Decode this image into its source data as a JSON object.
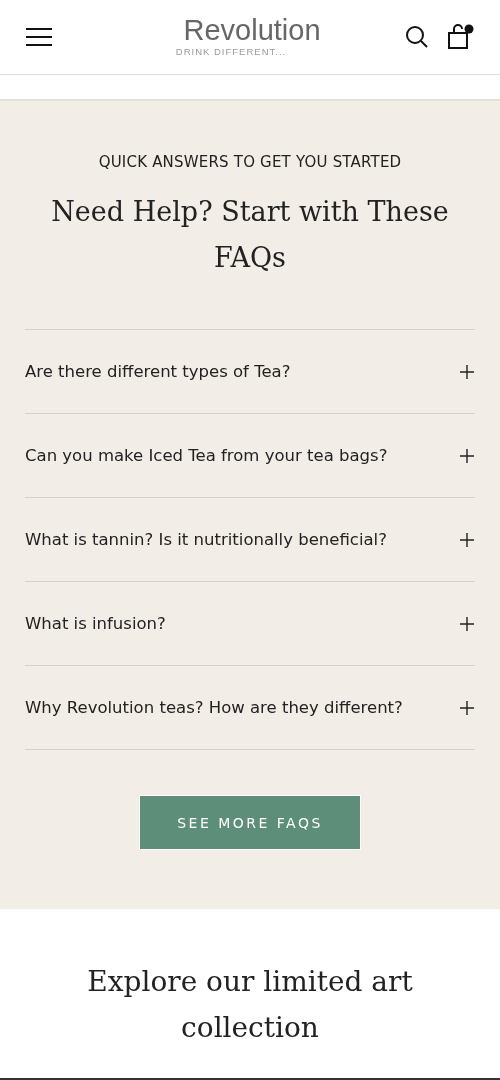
{
  "header": {
    "logo": "Revolution",
    "tagline": "DRINK DIFFERENT..."
  },
  "faq": {
    "eyebrow": "QUICK ANSWERS TO GET YOU STARTED",
    "title": "Need Help? Start with These FAQs",
    "items": [
      {
        "question": "Are there different types of Tea?",
        "expanded": false
      },
      {
        "question": "Can you make Iced Tea from your tea bags?",
        "expanded": false
      },
      {
        "question": "What is tannin? Is it nutritionally beneficial?",
        "expanded": false
      },
      {
        "question": "What is infusion?",
        "expanded": false
      },
      {
        "question": "Why Revolution teas? How are they different?",
        "expanded": false
      }
    ],
    "button": "SEE MORE FAQS"
  },
  "collection": {
    "title": "Explore our limited art collection"
  }
}
